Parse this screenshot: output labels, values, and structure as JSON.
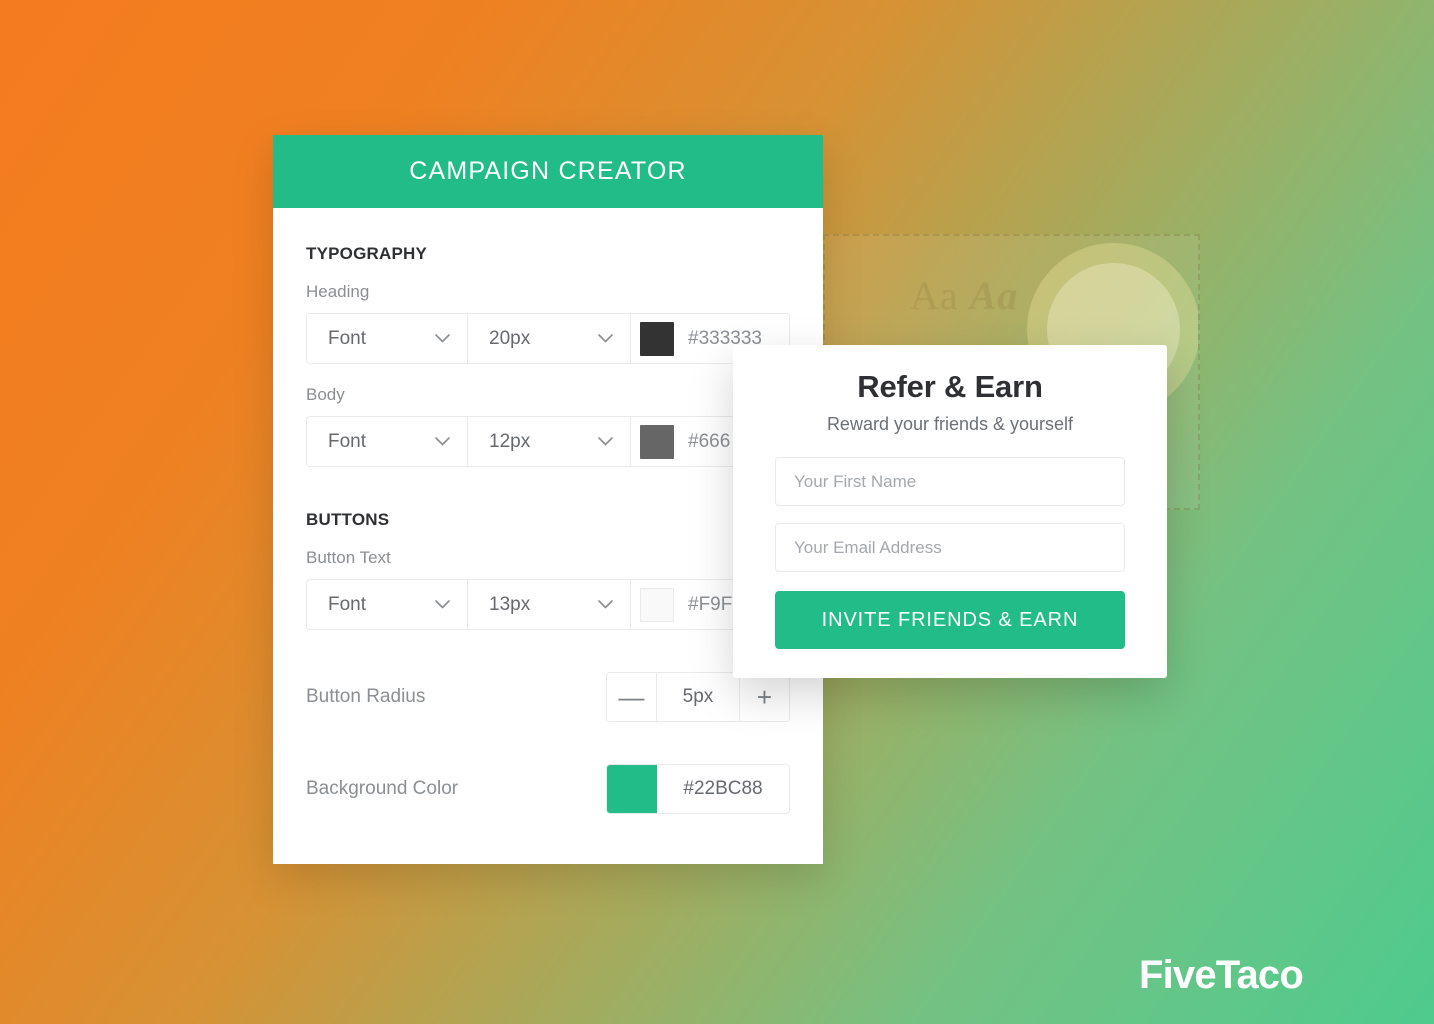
{
  "background": {
    "gradient_from": "#F47C20",
    "gradient_mid": "#A8A95A",
    "gradient_to": "#4ECB8D"
  },
  "ghost_preview": {
    "sample_text_regular": "Aa ",
    "sample_text_italic": "Aa"
  },
  "creator_panel": {
    "header_title": "CAMPAIGN CREATOR",
    "header_color": "#22BC88",
    "sections": {
      "typography": {
        "title": "TYPOGRAPHY",
        "rows": [
          {
            "label": "Heading",
            "font": "Font",
            "size": "20px",
            "swatch_color": "#333333",
            "hex": "#333333"
          },
          {
            "label": "Body",
            "font": "Font",
            "size": "12px",
            "swatch_color": "#666666",
            "hex": "#666"
          }
        ]
      },
      "buttons": {
        "title": "BUTTONS",
        "rows": [
          {
            "label": "Button Text",
            "font": "Font",
            "size": "13px",
            "swatch_color": "#F9F9F9",
            "hex": "#F9F"
          }
        ],
        "button_radius": {
          "label": "Button Radius",
          "decrement": "—",
          "value": "5px",
          "increment": "+"
        },
        "background_color": {
          "label": "Background Color",
          "swatch_color": "#22BC88",
          "hex": "#22BC88"
        }
      }
    }
  },
  "refer_card": {
    "title": "Refer & Earn",
    "subtitle": "Reward your friends & yourself",
    "first_name_placeholder": "Your First Name",
    "email_placeholder": "Your Email Address",
    "cta_label": "INVITE FRIENDS & EARN",
    "cta_color": "#22BC88"
  },
  "brand": {
    "name": "FiveTaco"
  }
}
